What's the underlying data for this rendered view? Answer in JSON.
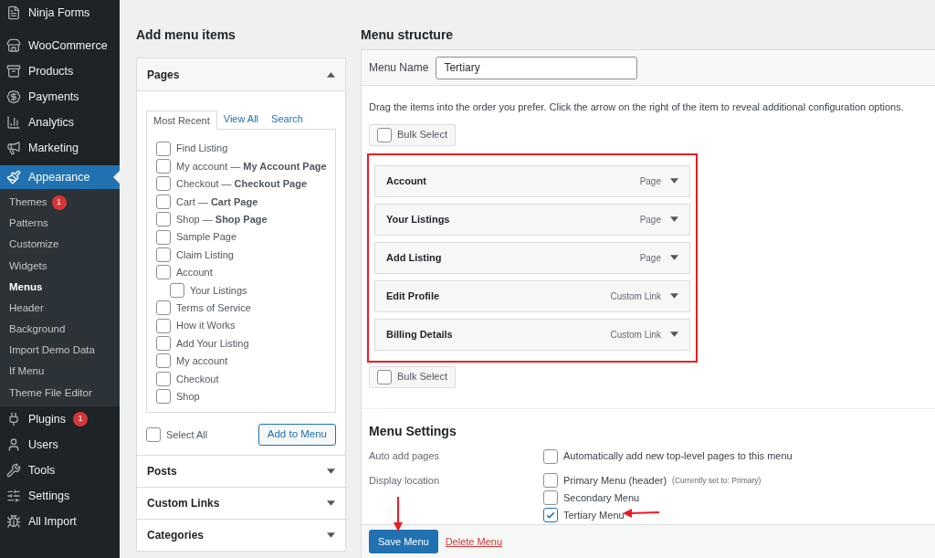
{
  "sidebar": {
    "items": [
      {
        "label": "Ninja Forms",
        "selected": false
      },
      {
        "label": "WooCommerce",
        "selected": false
      },
      {
        "label": "Products",
        "selected": false
      },
      {
        "label": "Payments",
        "selected": false
      },
      {
        "label": "Analytics",
        "selected": false
      },
      {
        "label": "Marketing",
        "selected": false
      },
      {
        "label": "Appearance",
        "selected": true,
        "children": [
          {
            "label": "Themes",
            "badge": "1",
            "selected": false
          },
          {
            "label": "Patterns",
            "selected": false
          },
          {
            "label": "Customize",
            "selected": false
          },
          {
            "label": "Widgets",
            "selected": false
          },
          {
            "label": "Menus",
            "selected": true
          },
          {
            "label": "Header",
            "selected": false
          },
          {
            "label": "Background",
            "selected": false
          },
          {
            "label": "Import Demo Data",
            "selected": false
          },
          {
            "label": "If Menu",
            "selected": false
          },
          {
            "label": "Theme File Editor",
            "selected": false
          }
        ]
      },
      {
        "label": "Plugins",
        "badge": "1",
        "selected": false
      },
      {
        "label": "Users",
        "selected": false
      },
      {
        "label": "Tools",
        "selected": false
      },
      {
        "label": "Settings",
        "selected": false
      },
      {
        "label": "All Import",
        "selected": false
      }
    ]
  },
  "add_menu_items": {
    "title": "Add menu items",
    "pages": {
      "title": "Pages",
      "expanded": true,
      "tabs": [
        {
          "label": "Most Recent",
          "selected": true
        },
        {
          "label": "View All",
          "selected": false
        },
        {
          "label": "Search",
          "selected": false
        }
      ],
      "items": [
        {
          "label": "Find Listing",
          "checked": false
        },
        {
          "label": "My account — **My Account Page**",
          "checked": false
        },
        {
          "label": "Checkout — **Checkout Page**",
          "checked": false
        },
        {
          "label": "Cart — **Cart Page**",
          "checked": false
        },
        {
          "label": "Shop — **Shop Page**",
          "checked": false
        },
        {
          "label": "Sample Page",
          "checked": false
        },
        {
          "label": "Claim Listing",
          "checked": false
        },
        {
          "label": "Account",
          "checked": false,
          "children": [
            {
              "label": "Your Listings",
              "checked": false
            }
          ]
        },
        {
          "label": "Terms of Service",
          "checked": false
        },
        {
          "label": "How it Works",
          "checked": false
        },
        {
          "label": "Add Your Listing",
          "checked": false
        },
        {
          "label": "My account",
          "checked": false
        },
        {
          "label": "Checkout",
          "checked": false
        },
        {
          "label": "Shop",
          "checked": false
        }
      ],
      "select_all": {
        "label": "Select All",
        "checked": false
      },
      "add_button": "Add to Menu"
    },
    "sections": [
      {
        "title": "Posts",
        "expanded": false
      },
      {
        "title": "Custom Links",
        "expanded": false
      },
      {
        "title": "Categories",
        "expanded": false
      }
    ]
  },
  "menu_structure": {
    "title": "Menu structure",
    "menu_name": {
      "label": "Menu Name",
      "value": "Tertiary"
    },
    "instructions": "Drag the items into the order you prefer. Click the arrow on the right of the item to reveal additional configuration options.",
    "bulk_select_top": {
      "label": "Bulk Select",
      "checked": false
    },
    "items": [
      {
        "title": "Account",
        "type": "Page"
      },
      {
        "title": "Your Listings",
        "type": "Page"
      },
      {
        "title": "Add Listing",
        "type": "Page"
      },
      {
        "title": "Edit Profile",
        "type": "Custom Link"
      },
      {
        "title": "Billing Details",
        "type": "Custom Link"
      }
    ],
    "bulk_select_bottom": {
      "label": "Bulk Select",
      "checked": false
    },
    "settings": {
      "title": "Menu Settings",
      "auto_add": {
        "label": "Auto add pages",
        "option": {
          "label": "Automatically add new top-level pages to this menu",
          "checked": false
        }
      },
      "display_location": {
        "label": "Display location",
        "options": [
          {
            "label": "Primary Menu (header)",
            "note": "(Currently set to: Primary)",
            "checked": false
          },
          {
            "label": "Secondary Menu",
            "checked": false
          },
          {
            "label": "Tertiary Menu",
            "checked": true
          }
        ]
      }
    },
    "save_button": "Save Menu",
    "delete_link": "Delete Menu"
  }
}
